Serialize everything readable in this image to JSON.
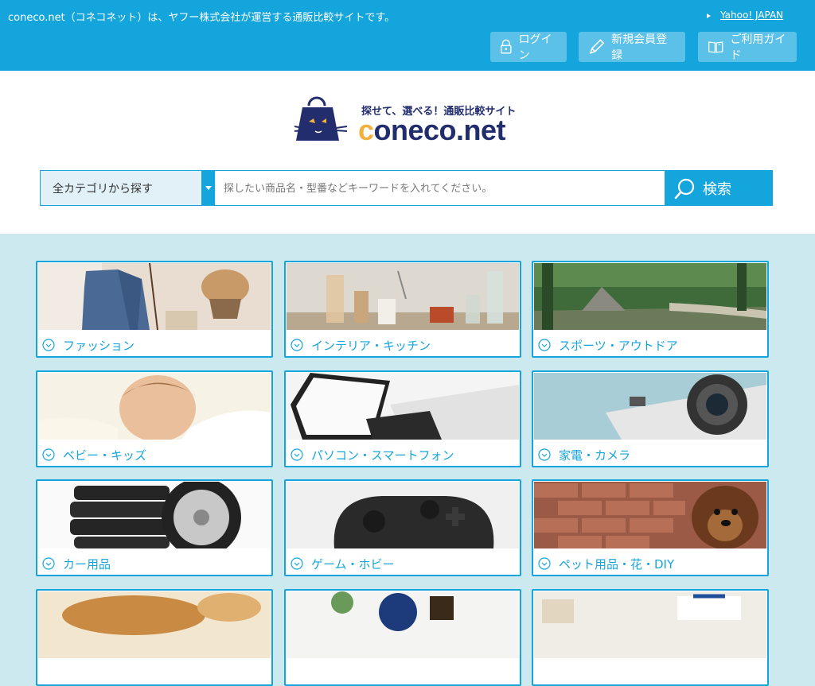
{
  "topbar": {
    "notice": "coneco.net（コネコネット）は、ヤフー株式会社が運営する通販比較サイトです。",
    "yahoo_link": "Yahoo! JAPAN",
    "login": "ログイン",
    "register": "新規会員登録",
    "guide": "ご利用ガイド"
  },
  "logo": {
    "tagline": "探せて、選べる！通販比較サイト",
    "brand_c": "c",
    "brand_rest": "oneco.net"
  },
  "search": {
    "category": "全カテゴリから探す",
    "placeholder": "探したい商品名・型番などキーワードを入れてください。",
    "button": "検索"
  },
  "categories": [
    {
      "label": "ファッション"
    },
    {
      "label": "インテリア・キッチン"
    },
    {
      "label": "スポーツ・アウトドア"
    },
    {
      "label": "ベビー・キッズ"
    },
    {
      "label": "パソコン・スマートフォン"
    },
    {
      "label": "家電・カメラ"
    },
    {
      "label": "カー用品"
    },
    {
      "label": "ゲーム・ホビー"
    },
    {
      "label": "ペット用品・花・DIY"
    }
  ],
  "colors": {
    "accent": "#14a5dc",
    "navy": "#222d6e",
    "background": "#cce9ef"
  }
}
